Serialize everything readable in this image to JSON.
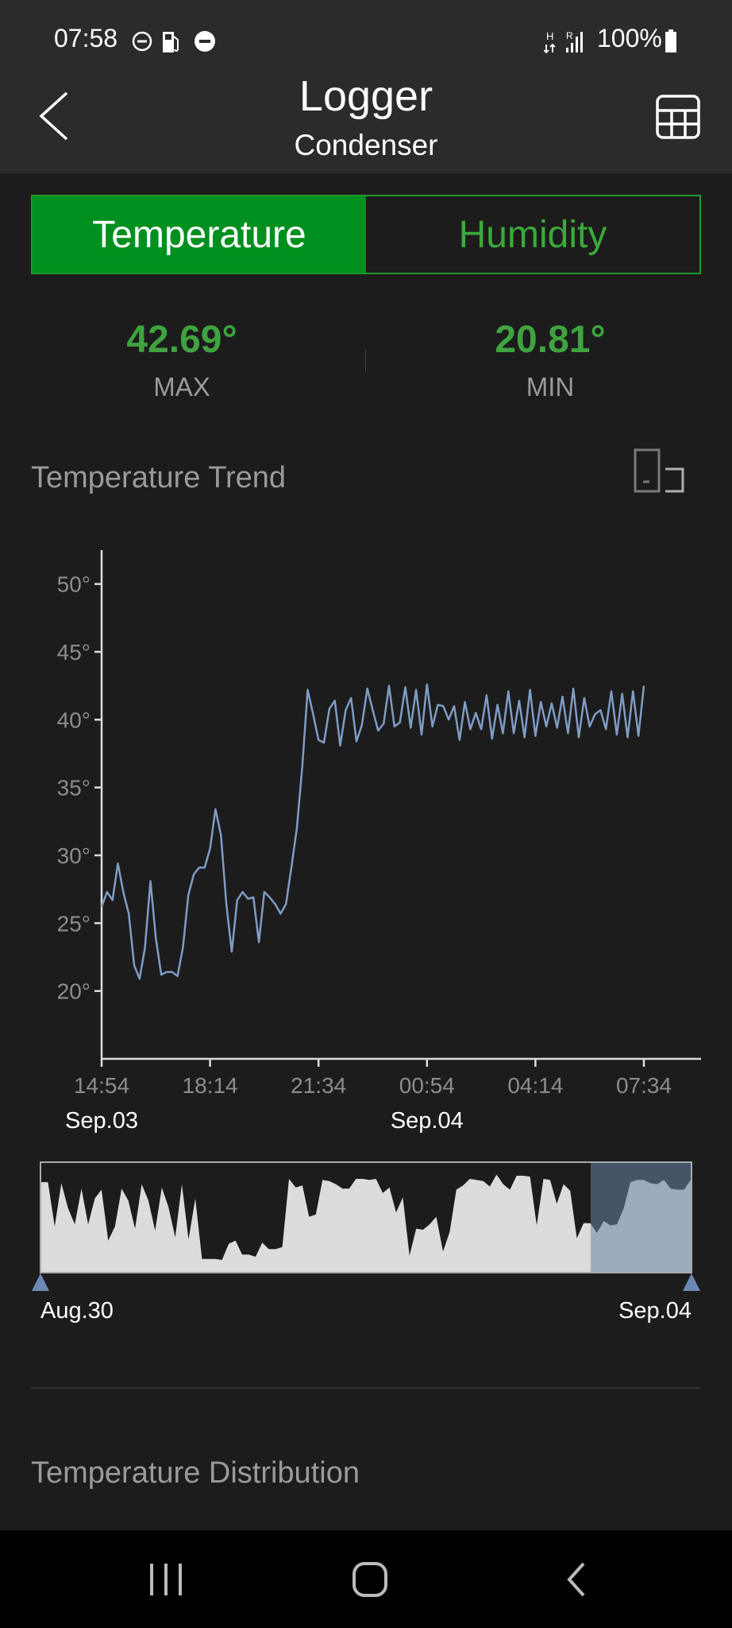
{
  "status_bar": {
    "time": "07:58",
    "battery": "100%",
    "network": "H",
    "signal_label": "R",
    "icons": [
      "do-not-disturb-icon",
      "fuel-icon",
      "minus-circle-icon",
      "data-arrows-icon",
      "signal-icon",
      "battery-icon"
    ]
  },
  "header": {
    "title": "Logger",
    "subtitle": "Condenser",
    "back_icon": "chevron-left-icon",
    "table_icon": "table-grid-icon"
  },
  "tabs": [
    {
      "label": "Temperature",
      "active": true
    },
    {
      "label": "Humidity",
      "active": false
    }
  ],
  "stats": {
    "max": {
      "value": "42.69°",
      "label": "MAX"
    },
    "min": {
      "value": "20.81°",
      "label": "MIN"
    }
  },
  "trend": {
    "title": "Temperature Trend",
    "rotate_icon": "rotate-screen-icon"
  },
  "colors": {
    "accent_green": "#00901f",
    "value_green": "#3fa33f",
    "line": "#7f9cc4",
    "navigator_selection": "#a9b7cb"
  },
  "chart_data": {
    "type": "line",
    "title": "",
    "ylim": [
      15,
      52.5
    ],
    "y_ticks": [
      {
        "value": 50,
        "label": "50°"
      },
      {
        "value": 45,
        "label": "45°"
      },
      {
        "value": 40,
        "label": "40°"
      },
      {
        "value": 35,
        "label": "35°"
      },
      {
        "value": 30,
        "label": "30°"
      },
      {
        "value": 25,
        "label": "25°"
      },
      {
        "value": 20,
        "label": "20°"
      }
    ],
    "x_ticks": [
      "14:54",
      "18:14",
      "21:34",
      "00:54",
      "04:14",
      "07:34"
    ],
    "x_dates": [
      {
        "label": "Sep.03",
        "at": "14:54"
      },
      {
        "label": "Sep.04",
        "at": "00:54"
      }
    ],
    "x_start": "Sep.03 14:54",
    "x_end": "Sep.04 07:34",
    "grid": false,
    "series": [
      {
        "values": [
          26.2,
          27.3,
          26.7,
          29.4,
          27.3,
          25.7,
          21.9,
          20.9,
          23.2,
          28.1,
          23.9,
          21.2,
          21.4,
          21.4,
          21.1,
          23.2,
          27.1,
          28.6,
          29.1,
          29.1,
          30.5,
          33.4,
          31.5,
          26.4,
          22.9,
          26.7,
          27.3,
          26.8,
          26.9,
          23.6,
          27.3,
          26.9,
          26.4,
          25.7,
          26.4,
          29.1,
          32.0,
          36.5,
          42.2,
          40.4,
          38.5,
          38.3,
          40.8,
          41.4,
          38.1,
          40.7,
          41.6,
          38.4,
          39.6,
          42.3,
          40.7,
          39.2,
          39.7,
          42.5,
          39.5,
          39.8,
          42.4,
          39.4,
          42.2,
          38.9,
          42.6,
          39.5,
          41.1,
          41.0,
          40.0,
          41.0,
          38.5,
          41.3,
          39.3,
          40.5,
          39.3,
          41.8,
          38.6,
          41.1,
          39.0,
          42.1,
          39.0,
          41.4,
          38.7,
          42.2,
          38.8,
          41.3,
          39.5,
          41.2,
          39.4,
          41.7,
          39.0,
          42.3,
          38.7,
          41.6,
          39.5,
          40.4,
          40.7,
          39.3,
          42.1,
          38.9,
          41.9,
          38.7,
          42.1,
          38.8,
          42.5
        ]
      }
    ]
  },
  "navigator": {
    "start_label": "Aug.30",
    "end_label": "Sep.04",
    "selection_start_fraction": 0.846,
    "selection_end_fraction": 1.0,
    "overview_levels_percent": [
      83,
      83,
      42,
      82,
      59,
      44,
      77,
      44,
      68,
      76,
      29,
      42,
      77,
      66,
      40,
      81,
      66,
      38,
      78,
      60,
      32,
      81,
      30,
      68,
      12,
      12,
      12,
      11,
      26,
      29,
      16,
      16,
      14,
      27,
      21,
      21,
      23,
      86,
      78,
      80,
      51,
      53,
      85,
      84,
      81,
      77,
      77,
      86,
      86,
      85,
      86,
      73,
      78,
      55,
      69,
      15,
      40,
      39,
      44,
      51,
      19,
      37,
      76,
      80,
      86,
      85,
      84,
      79,
      90,
      81,
      76,
      89,
      89,
      88,
      43,
      86,
      85,
      63,
      81,
      75,
      31,
      45,
      45,
      36,
      47,
      43,
      44,
      59,
      83,
      85,
      85,
      82,
      81,
      85,
      77,
      76,
      76,
      85
    ]
  },
  "distribution": {
    "title": "Temperature Distribution"
  },
  "nav_bar": {
    "icons": [
      "recent-apps-icon",
      "home-icon",
      "back-icon"
    ]
  }
}
